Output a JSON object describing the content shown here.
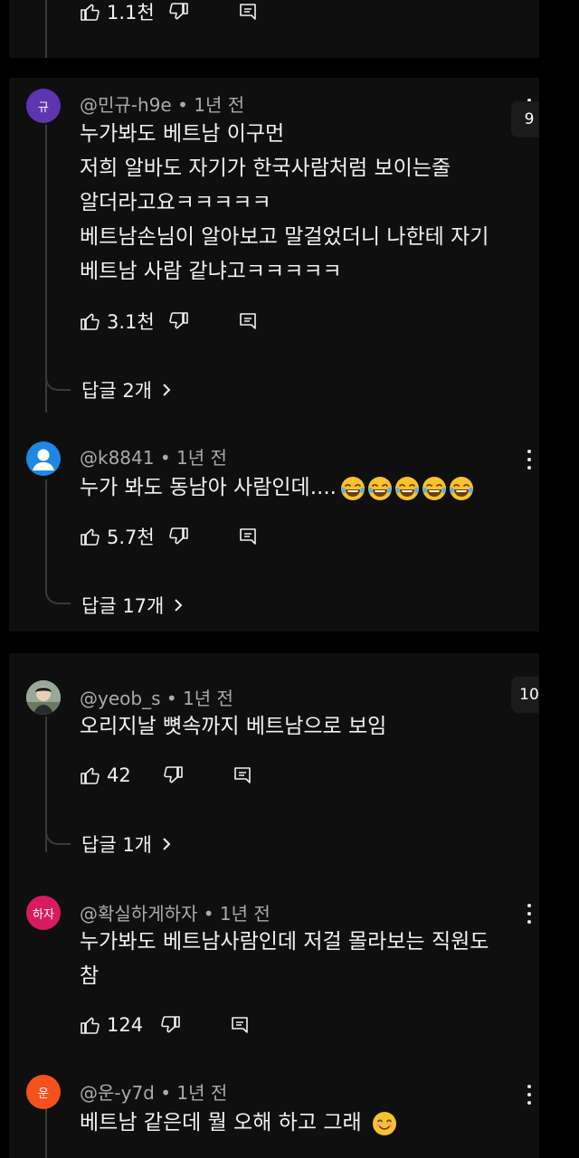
{
  "comments": [
    {
      "likes": "1.1천"
    },
    {
      "avatar_letter": "규",
      "avatar_color": "#5e35b1",
      "author": "@민규-h9e",
      "time": "1년 전",
      "lines": [
        "누가봐도 베트남 이구먼",
        "저희 알바도 자기가 한국사람처럼 보이는줄",
        "알더라고요ㅋㅋㅋㅋㅋ",
        "베트남손님이 알아보고 말걸었더니 나한테 자기",
        "베트남 사람 같냐고ㅋㅋㅋㅋㅋ"
      ],
      "likes": "3.1천",
      "replies": "답글 2개",
      "badge": "9"
    },
    {
      "avatar_color": "#1e88e5",
      "author": "@k8841",
      "time": "1년 전",
      "text": "누가 봐도 동남아 사람인데....",
      "emoji_count": 5,
      "likes": "5.7천",
      "replies": "답글 17개"
    },
    {
      "author": "@yeob_s",
      "time": "1년 전",
      "text": "오리지날 뼛속까지 베트남으로 보임",
      "likes": "42",
      "replies": "답글 1개",
      "badge": "10"
    },
    {
      "avatar_letter": "하자",
      "avatar_color": "#d81b60",
      "author": "@확실하게하자",
      "time": "1년 전",
      "lines": [
        "누가봐도 베트남사람인데 저걸 몰라보는 직원도",
        "참"
      ],
      "likes": "124"
    },
    {
      "avatar_letter": "운",
      "avatar_color": "#f4511e",
      "author": "@운-y7d",
      "time": "1년 전",
      "text": "베트남 같은데 뭘 오해 하고 그래"
    }
  ],
  "meta_separator": " • "
}
